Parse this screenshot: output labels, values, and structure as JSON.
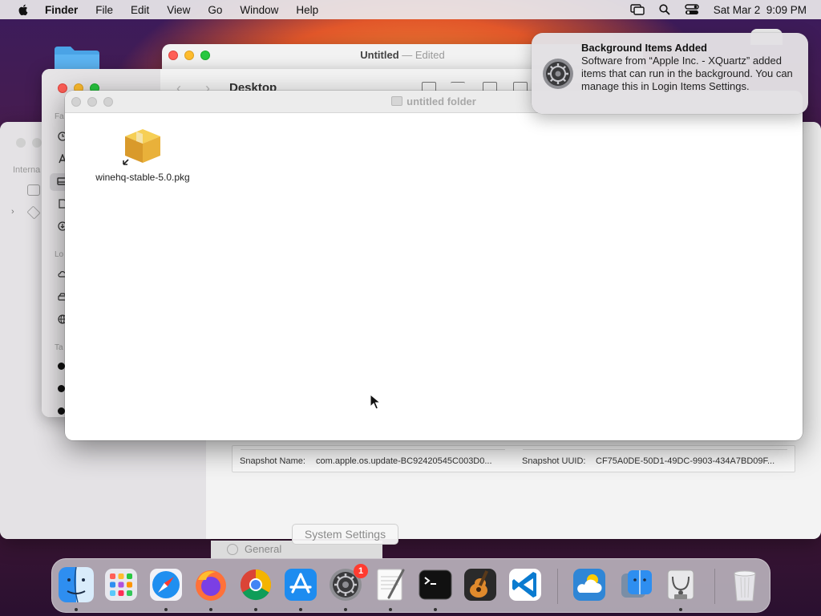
{
  "menubar": {
    "app_name": "Finder",
    "items": [
      "File",
      "Edit",
      "View",
      "Go",
      "Window",
      "Help"
    ],
    "datetime": "Sat Mar 2  9:09 PM"
  },
  "untitled_window": {
    "title": "Untitled",
    "title_suffix": "— Edited"
  },
  "desktop_window": {
    "title": "Desktop"
  },
  "folder_window": {
    "title": "untitled folder",
    "files": [
      {
        "name": "winehq-stable-5.0.pkg",
        "icon": "package-icon"
      }
    ]
  },
  "notification": {
    "title": "Background Items Added",
    "body": "Software from “Apple Inc. - XQuartz” added items that can run in the background. You can manage this in Login Items Settings.",
    "icon": "settings-gear-icon"
  },
  "settings_window": {
    "snapshot_name_label": "Snapshot Name:",
    "snapshot_name_value": "com.apple.os.update-BC92420545C003D0...",
    "snapshot_uuid_label": "Snapshot UUID:",
    "snapshot_uuid_value": "CF75A0DE-50D1-49DC-9903-434A7BD09F...",
    "general_label": "General"
  },
  "dock": {
    "tooltip": "System Settings",
    "settings_badge": "1",
    "items": [
      "Finder",
      "Launchpad",
      "Safari",
      "Firefox",
      "Chrome",
      "App Store",
      "System Settings",
      "TextEdit",
      "Terminal",
      "GarageBand",
      "Visual Studio Code",
      "Weather",
      "Migration Assistant",
      "Disk Utility",
      "Trash"
    ]
  },
  "colors": {
    "close": "#ff5f57",
    "minimize": "#febc2e",
    "zoom": "#28c840",
    "badge": "#ff3b30"
  }
}
